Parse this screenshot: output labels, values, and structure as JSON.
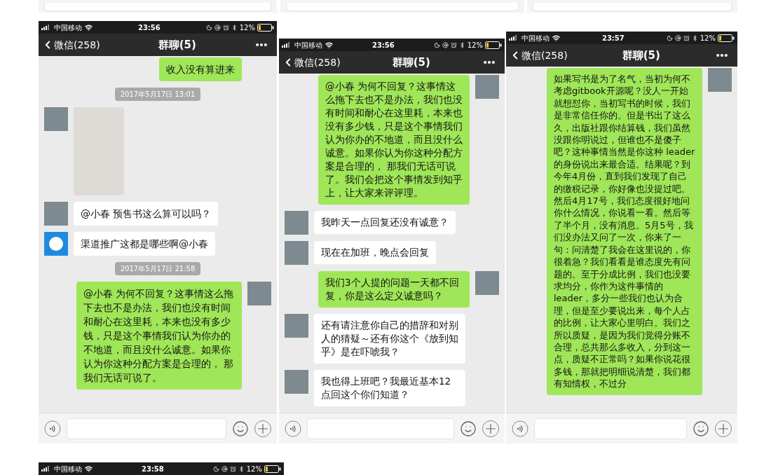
{
  "top_fragments": [
    {
      "kind": "input_bar"
    },
    {
      "kind": "input_bar"
    },
    {
      "kind": "input_bar"
    }
  ],
  "screenshots": [
    {
      "status": {
        "carrier": "中国移动",
        "time": "23:56",
        "battery": "12%"
      },
      "nav": {
        "back": "微信(258)",
        "title": "群聊(5)"
      },
      "messages": [
        {
          "kind": "outgoing",
          "text": "收入没有算进来"
        },
        {
          "kind": "time",
          "text": "2017年5月17日 13:01"
        },
        {
          "kind": "image",
          "avatar": {
            "kind": "photo"
          }
        },
        {
          "kind": "incoming",
          "text": "@小春 预售书这么算可以吗？",
          "avatar": {
            "kind": "photo"
          }
        },
        {
          "kind": "incoming",
          "text": "渠道推广这都是哪些啊@小春",
          "avatar": {
            "kind": "cartoon"
          }
        },
        {
          "kind": "time",
          "text": "2017年5月17日 21:58"
        },
        {
          "kind": "outgoing",
          "text": "@小春 为何不回复？这事情这么拖下去也不是办法，我们也没有时间和耐心在这里耗，本来也没有多少钱，只是这个事情我们认为你办的不地道，而且没什么诚意。如果你认为你这种分配方案是合理的， 那我们无话可说了。",
          "avatar": {
            "kind": "photo"
          }
        }
      ]
    },
    {
      "status": {
        "carrier": "中国移动",
        "time": "23:56",
        "battery": "12%"
      },
      "nav": {
        "back": "微信(258)",
        "title": "群聊(5)"
      },
      "messages": [
        {
          "kind": "outgoing",
          "text": "@小春 为何不回复？这事情这么拖下去也不是办法，我们也没有时间和耐心在这里耗，本来也没有多少钱，只是这个事情我们认为你办的不地道，而且没什么诚意。如果你认为你这种分配方案是合理的， 那我们无话可说了。我们会把这个事情发到知乎上，让大家来评评理。",
          "avatar": {
            "kind": "photo"
          }
        },
        {
          "kind": "incoming",
          "text": "我昨天一点回复还没有诚意？",
          "avatar": {
            "kind": "photo"
          }
        },
        {
          "kind": "incoming",
          "text": "现在在加班，晚点会回复",
          "avatar": {
            "kind": "photo"
          }
        },
        {
          "kind": "outgoing",
          "text": "我们3个人提的问题一天都不回复，你是这么定义诚意吗？",
          "avatar": {
            "kind": "photo"
          }
        },
        {
          "kind": "incoming",
          "text": "还有请注意你自己的措辞和对别人的猜疑～还有你这个《放到知乎》是在吓唬我？",
          "avatar": {
            "kind": "photo"
          }
        },
        {
          "kind": "incoming",
          "text": "我也得上班吧？我最近基本12点回这个你们知道？",
          "avatar": {
            "kind": "photo"
          }
        }
      ]
    },
    {
      "status": {
        "carrier": "中国移动",
        "time": "23:57",
        "battery": "12%"
      },
      "nav": {
        "back": "微信(258)",
        "title": "群聊(5)"
      },
      "messages": [
        {
          "kind": "outgoing",
          "text": "如果写书是为了名气，当初为何不考虑gitbook开源呢？没人一开始就想怼你，当初写书的时候，我们是非常信任你的。但是书出了这么久，出版社跟你结算钱，我们虽然没跟你明说过，但谁也不是傻子吧？这种事情当然是你这种 leader 的身份说出来最合适。结果呢？到今年4月份，直到我们发现了自己的缴税记录，你好像也没提过吧。然后4月17号，我们态度很好地问你什么情况，你说看一看。然后等了半个月，没有消息。5月5号，我们没办法又问了一次，你来了一句：问清楚了我会在这里说的，你很着急？我们看看是谁态度先有问题的。至于分成比例，我们也没要求均分，你作为这件事情的leader，多分一些我们也认为合理，但是至少要说出来，每个人占的比例，让大家心里明白。我们之所以质疑，是因为我们觉得分账不合理，总共那么多收入，分到这一点，质疑不正常吗？如果你说花很多钱，那就把明细说清楚，我们都有知情权，不过分",
          "avatar": {
            "kind": "photo"
          }
        }
      ]
    }
  ],
  "bottom_screenshot": {
    "status": {
      "carrier": "中国移动",
      "time": "23:58",
      "battery": "12%"
    }
  }
}
